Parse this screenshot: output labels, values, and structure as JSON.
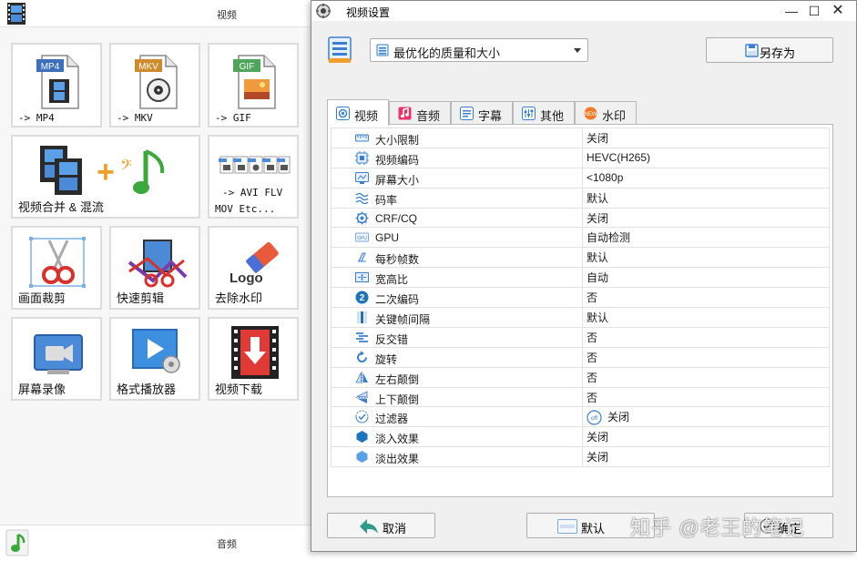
{
  "background_app": {
    "section_title": "视频",
    "footer_title": "音频",
    "tiles": [
      {
        "label": "-> MP4",
        "badge": "MP4"
      },
      {
        "label": "-> MKV",
        "badge": "MKV"
      },
      {
        "label": "-> GIF",
        "badge": "GIF"
      },
      {
        "label": "视频合并 & 混流"
      },
      {
        "label_line1": "-> AVI FLV",
        "label_line2": "MOV Etc..."
      },
      {
        "label": "画面裁剪"
      },
      {
        "label": "快速剪辑"
      },
      {
        "label": "去除水印",
        "logo_text": "Logo"
      },
      {
        "label": "屏幕录像"
      },
      {
        "label": "格式播放器"
      },
      {
        "label": "视频下载"
      }
    ]
  },
  "dialog": {
    "title": "视频设置",
    "controls": {
      "minimize": "—",
      "maximize": "☐",
      "close": "✕"
    },
    "preset": {
      "value": "最优化的质量和大小"
    },
    "save_as_label": "另存为",
    "tabs": [
      {
        "label": "视频",
        "icon": "video-tab-icon",
        "active": true
      },
      {
        "label": "音频",
        "icon": "audio-tab-icon",
        "active": false
      },
      {
        "label": "字幕",
        "icon": "subtitle-tab-icon",
        "active": false
      },
      {
        "label": "其他",
        "icon": "other-tab-icon",
        "active": false
      },
      {
        "label": "水印",
        "icon": "watermark-tab-icon",
        "active": false
      }
    ],
    "properties": [
      {
        "name": "大小限制",
        "value": "关闭",
        "icon": "size-limit-icon"
      },
      {
        "name": "视频编码",
        "value": "HEVC(H265)",
        "icon": "video-codec-icon"
      },
      {
        "name": "屏幕大小",
        "value": "<1080p",
        "icon": "screen-size-icon"
      },
      {
        "name": "码率",
        "value": "默认",
        "icon": "bitrate-icon"
      },
      {
        "name": "CRF/CQ",
        "value": "关闭",
        "icon": "crf-icon"
      },
      {
        "name": "GPU",
        "value": "自动检测",
        "icon": "gpu-icon",
        "icon_text": "GPU"
      },
      {
        "name": "每秒帧数",
        "value": "默认",
        "icon": "fps-icon"
      },
      {
        "name": "宽高比",
        "value": "自动",
        "icon": "aspect-ratio-icon"
      },
      {
        "name": "二次编码",
        "value": "否",
        "icon": "two-pass-icon",
        "icon_text": "2"
      },
      {
        "name": "关键帧间隔",
        "value": "默认",
        "icon": "keyframe-icon"
      },
      {
        "name": "反交错",
        "value": "否",
        "icon": "deinterlace-icon"
      },
      {
        "name": "旋转",
        "value": "否",
        "icon": "rotate-icon"
      },
      {
        "name": "左右颠倒",
        "value": "否",
        "icon": "flip-horizontal-icon"
      },
      {
        "name": "上下颠倒",
        "value": "否",
        "icon": "flip-vertical-icon"
      },
      {
        "name": "过滤器",
        "value": "关闭",
        "icon": "filter-icon",
        "value_icon_text": "off"
      },
      {
        "name": "淡入效果",
        "value": "关闭",
        "icon": "fade-in-icon"
      },
      {
        "name": "淡出效果",
        "value": "关闭",
        "icon": "fade-out-icon"
      }
    ],
    "buttons": {
      "cancel": "取消",
      "default": "默认",
      "ok": "确定"
    }
  },
  "watermark_text": "知乎 @老王的笔记",
  "colors": {
    "accent_blue": "#1e73be",
    "tab_active_bg": "#ffffff",
    "dialog_bg": "#f0f0f0",
    "grid": "#e1e1e1"
  }
}
